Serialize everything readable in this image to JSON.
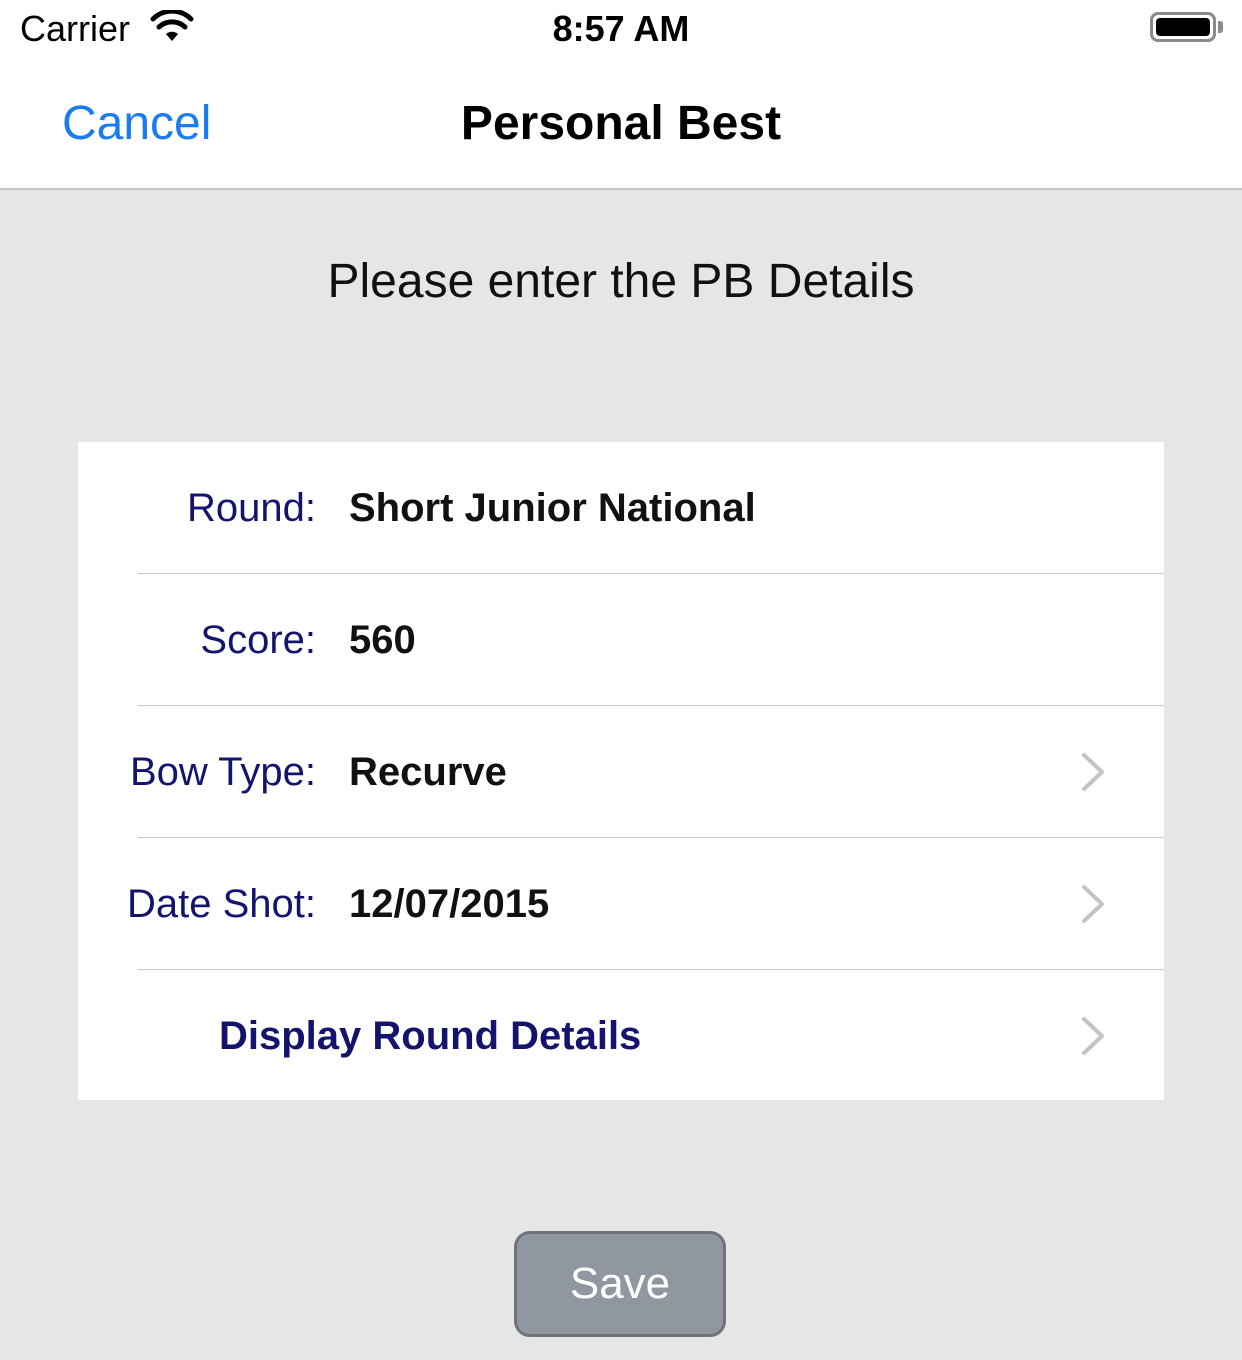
{
  "status_bar": {
    "carrier": "Carrier",
    "time": "8:57 AM"
  },
  "nav": {
    "cancel_label": "Cancel",
    "title": "Personal Best"
  },
  "instructions": "Please enter the PB Details",
  "form": {
    "rows": [
      {
        "label": "Round:",
        "value": "Short Junior National"
      },
      {
        "label": "Score:",
        "value": "560"
      },
      {
        "label": "Bow Type:",
        "value": "Recurve"
      },
      {
        "label": "Date Shot:",
        "value": "12/07/2015"
      }
    ],
    "details_link": "Display Round Details"
  },
  "save_label": "Save",
  "colors": {
    "accent_blue": "#1a7cf0",
    "label_navy": "#14146e",
    "background": "#e6e6e6",
    "save_button": "#9097a0"
  }
}
